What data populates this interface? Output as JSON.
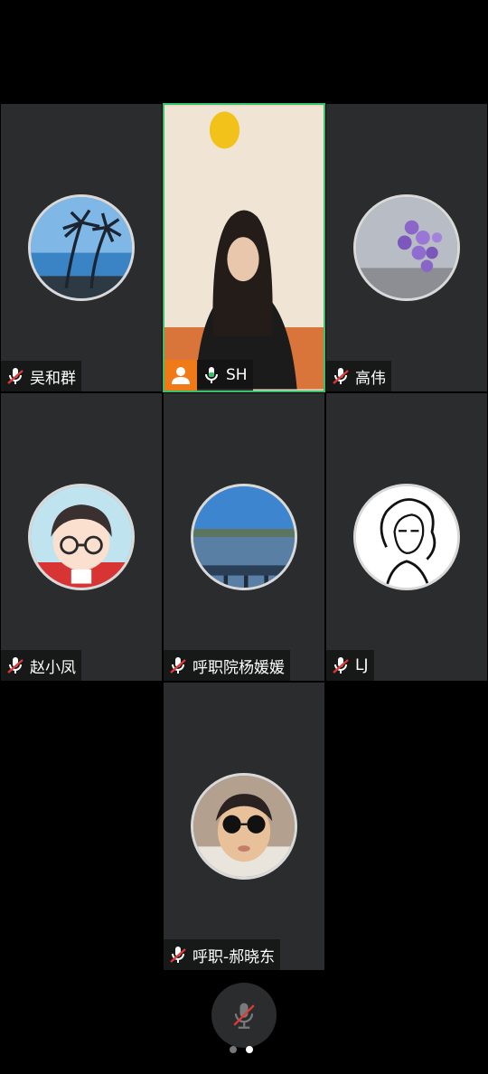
{
  "participants": [
    {
      "name": "吴和群",
      "mic": "muted",
      "avatar": "palm-trees-beach"
    },
    {
      "name": "SH",
      "mic": "on",
      "host": true,
      "video": "woman-video-feed"
    },
    {
      "name": "高伟",
      "mic": "muted",
      "avatar": "purple-flowers"
    },
    {
      "name": "赵小凤",
      "mic": "muted",
      "avatar": "cartoon-boy-glasses"
    },
    {
      "name": "呼职院杨媛媛",
      "mic": "muted",
      "avatar": "lake-pier"
    },
    {
      "name": "LJ",
      "mic": "muted",
      "avatar": "line-drawing-girl"
    },
    {
      "name": "呼职-郝晓东",
      "mic": "muted",
      "avatar": "child-sunglasses"
    }
  ],
  "controls": {
    "mute_button": "mic-muted-icon"
  },
  "pagination": {
    "pages": 2,
    "current": 2
  },
  "colors": {
    "tile_bg": "#2b2c2e",
    "active_border": "#35c26b",
    "host_badge": "#f07a18",
    "mic_muted_red": "#e53935",
    "mic_on_green": "#35c26b"
  }
}
